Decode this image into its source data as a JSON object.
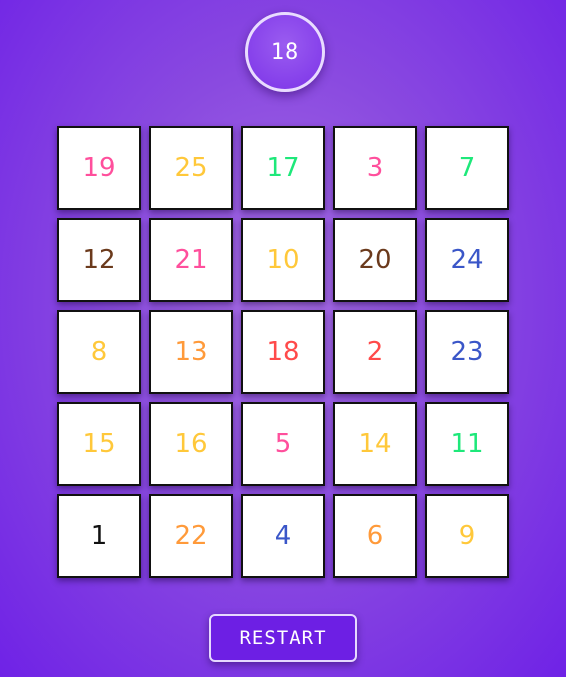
{
  "timer": {
    "value": "18"
  },
  "colors": {
    "pink": "#ff4f9c",
    "yellow": "#ffc83a",
    "green": "#1ee87a",
    "brown": "#6b3a1c",
    "blue": "#3a56c8",
    "orange": "#ff9a3a",
    "red": "#ff4a4a",
    "black": "#111111"
  },
  "board": {
    "tiles": [
      {
        "number": "19",
        "color": "pink"
      },
      {
        "number": "25",
        "color": "yellow"
      },
      {
        "number": "17",
        "color": "green"
      },
      {
        "number": "3",
        "color": "pink"
      },
      {
        "number": "7",
        "color": "green"
      },
      {
        "number": "12",
        "color": "brown"
      },
      {
        "number": "21",
        "color": "pink"
      },
      {
        "number": "10",
        "color": "yellow"
      },
      {
        "number": "20",
        "color": "brown"
      },
      {
        "number": "24",
        "color": "blue"
      },
      {
        "number": "8",
        "color": "yellow"
      },
      {
        "number": "13",
        "color": "orange"
      },
      {
        "number": "18",
        "color": "red"
      },
      {
        "number": "2",
        "color": "red"
      },
      {
        "number": "23",
        "color": "blue"
      },
      {
        "number": "15",
        "color": "yellow"
      },
      {
        "number": "16",
        "color": "yellow"
      },
      {
        "number": "5",
        "color": "pink"
      },
      {
        "number": "14",
        "color": "yellow"
      },
      {
        "number": "11",
        "color": "green"
      },
      {
        "number": "1",
        "color": "black"
      },
      {
        "number": "22",
        "color": "orange"
      },
      {
        "number": "4",
        "color": "blue"
      },
      {
        "number": "6",
        "color": "orange"
      },
      {
        "number": "9",
        "color": "yellow"
      }
    ]
  },
  "controls": {
    "restart_label": "RESTART"
  }
}
